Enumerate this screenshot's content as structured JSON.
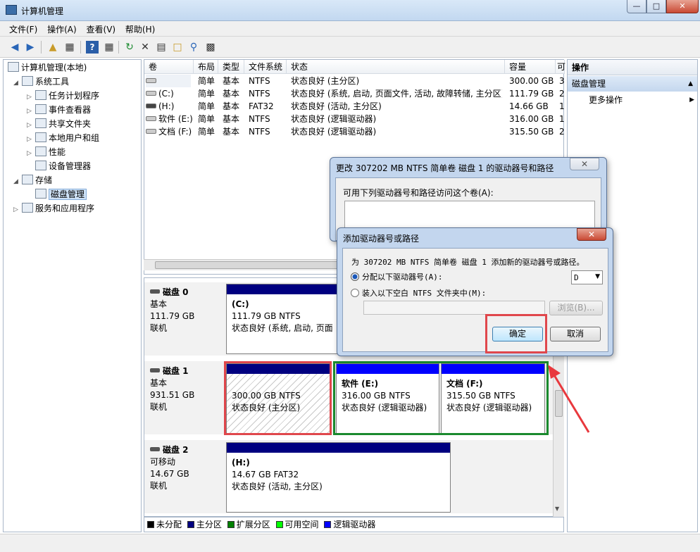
{
  "window": {
    "title": "计算机管理"
  },
  "menu": [
    "文件(F)",
    "操作(A)",
    "查看(V)",
    "帮助(H)"
  ],
  "tree": {
    "root": "计算机管理(本地)",
    "system_tools": "系统工具",
    "task_scheduler": "任务计划程序",
    "event_viewer": "事件查看器",
    "shared_folders": "共享文件夹",
    "local_users": "本地用户和组",
    "performance": "性能",
    "device_manager": "设备管理器",
    "storage": "存储",
    "disk_management": "磁盘管理",
    "services": "服务和应用程序"
  },
  "volumes": {
    "headers": [
      "卷",
      "布局",
      "类型",
      "文件系统",
      "状态",
      "容量",
      "可"
    ],
    "rows": [
      [
        "",
        "简单",
        "基本",
        "NTFS",
        "状态良好 (主分区)",
        "300.00 GB",
        "3"
      ],
      [
        "(C:)",
        "简单",
        "基本",
        "NTFS",
        "状态良好 (系统, 启动, 页面文件, 活动, 故障转储, 主分区)",
        "111.79 GB",
        "2"
      ],
      [
        "(H:)",
        "简单",
        "基本",
        "FAT32",
        "状态良好 (活动, 主分区)",
        "14.66 GB",
        "1"
      ],
      [
        "软件 (E:)",
        "简单",
        "基本",
        "NTFS",
        "状态良好 (逻辑驱动器)",
        "316.00 GB",
        "1"
      ],
      [
        "文档 (F:)",
        "简单",
        "基本",
        "NTFS",
        "状态良好 (逻辑驱动器)",
        "315.50 GB",
        "2"
      ]
    ]
  },
  "disks": {
    "disk0": {
      "name": "磁盘 0",
      "type": "基本",
      "size": "111.79 GB",
      "status": "联机",
      "part_c": {
        "label": "(C:)",
        "size": "111.79 GB NTFS",
        "status": "状态良好 (系统, 启动, 页面"
      }
    },
    "disk1": {
      "name": "磁盘 1",
      "type": "基本",
      "size": "931.51 GB",
      "status": "联机",
      "part_unlettered": {
        "size": "300.00 GB NTFS",
        "status": "状态良好 (主分区)"
      },
      "part_e": {
        "label": "软件  (E:)",
        "size": "316.00 GB NTFS",
        "status": "状态良好 (逻辑驱动器)"
      },
      "part_f": {
        "label": "文档  (F:)",
        "size": "315.50 GB NTFS",
        "status": "状态良好 (逻辑驱动器)"
      }
    },
    "disk2": {
      "name": "磁盘 2",
      "type": "可移动",
      "size": "14.67 GB",
      "status": "联机",
      "part_h": {
        "label": "(H:)",
        "size": "14.67 GB FAT32",
        "status": "状态良好 (活动, 主分区)"
      }
    }
  },
  "legend": [
    {
      "label": "未分配",
      "color": "#000000"
    },
    {
      "label": "主分区",
      "color": "#000080"
    },
    {
      "label": "扩展分区",
      "color": "#008000"
    },
    {
      "label": "可用空间",
      "color": "#00ff00"
    },
    {
      "label": "逻辑驱动器",
      "color": "#0000ff"
    }
  ],
  "actions": {
    "header": "操作",
    "section": "磁盘管理",
    "more": "更多操作"
  },
  "dialog_change": {
    "title": "更改 307202 MB NTFS 简单卷 磁盘 1 的驱动器号和路径",
    "label": "可用下列驱动器号和路径访问这个卷(A):"
  },
  "dialog_add": {
    "title": "添加驱动器号或路径",
    "description": "为 307202 MB NTFS 简单卷 磁盘 1 添加新的驱动器号或路径。",
    "option_letter": "分配以下驱动器号(A):",
    "letter_value": "D",
    "option_folder": "装入以下空白 NTFS 文件夹中(M):",
    "browse": "浏览(B)...",
    "ok": "确定",
    "cancel": "取消"
  }
}
